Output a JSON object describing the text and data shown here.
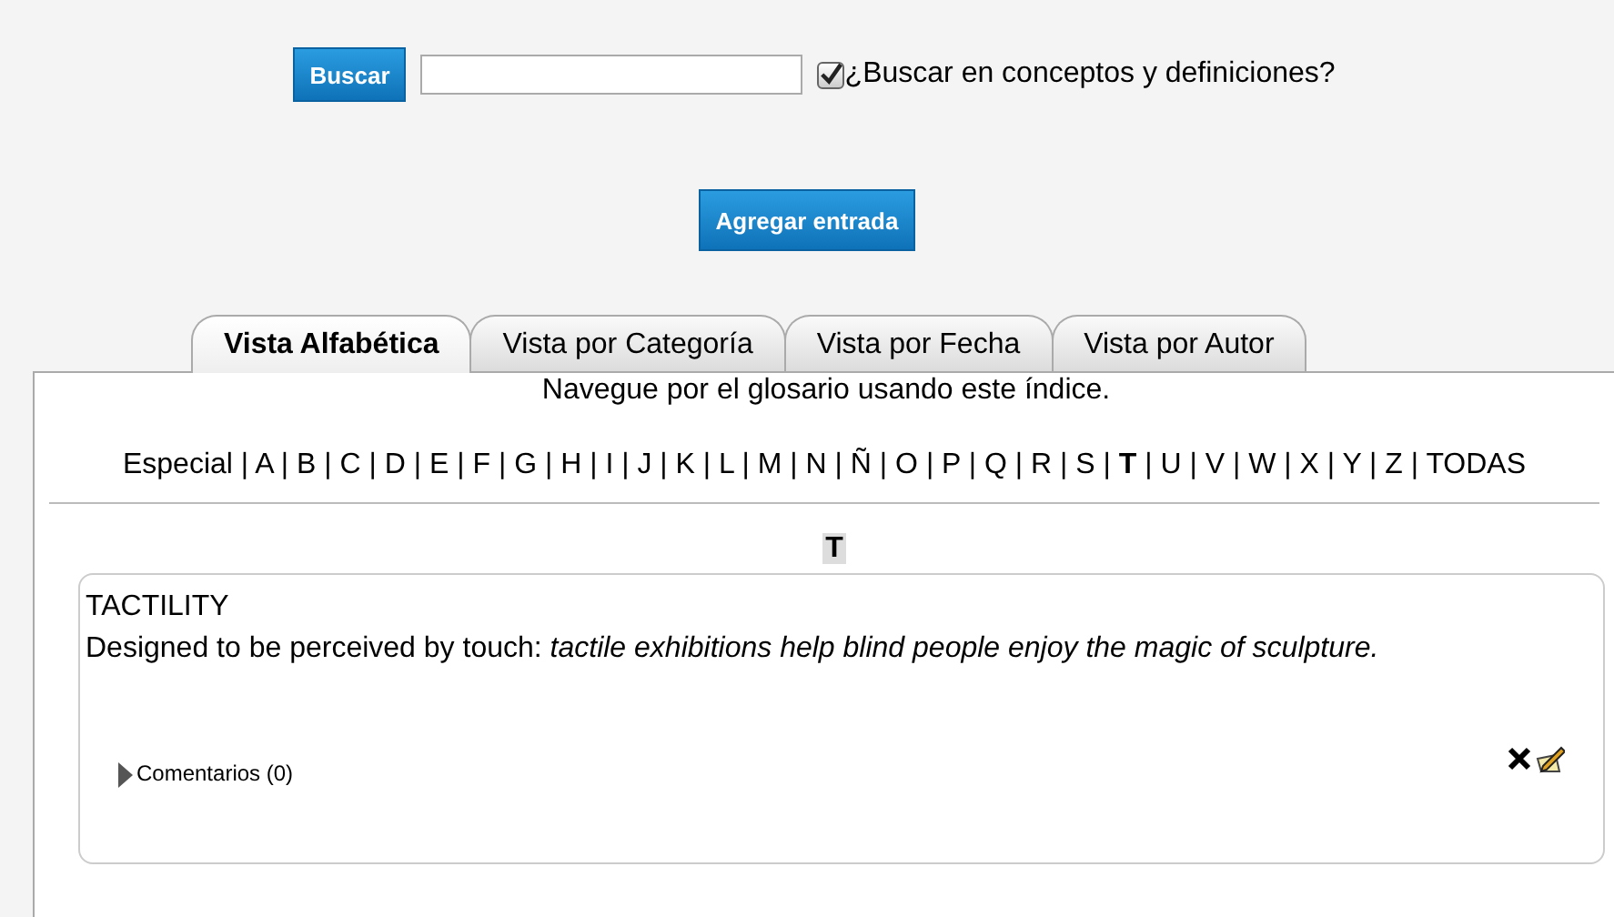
{
  "search": {
    "button": "Buscar",
    "option": {
      "label": "¿Buscar en conceptos y definiciones?",
      "checked": true
    }
  },
  "add_button": "Agregar entrada",
  "tabs": [
    {
      "label": "Vista Alfabética",
      "selected": true
    },
    {
      "label": "Vista por Categoría",
      "selected": false
    },
    {
      "label": "Vista por Fecha",
      "selected": false
    },
    {
      "label": "Vista por Autor",
      "selected": false
    }
  ],
  "index": {
    "hint": "Navegue por el glosario usando este índice.",
    "separator": "|",
    "letters": [
      {
        "label": "Especial",
        "selected": false
      },
      {
        "label": "A",
        "selected": false
      },
      {
        "label": "B",
        "selected": false
      },
      {
        "label": "C",
        "selected": false
      },
      {
        "label": "D",
        "selected": false
      },
      {
        "label": "E",
        "selected": false
      },
      {
        "label": "F",
        "selected": false
      },
      {
        "label": "G",
        "selected": false
      },
      {
        "label": "H",
        "selected": false
      },
      {
        "label": "I",
        "selected": false
      },
      {
        "label": "J",
        "selected": false
      },
      {
        "label": "K",
        "selected": false
      },
      {
        "label": "L",
        "selected": false
      },
      {
        "label": "M",
        "selected": false
      },
      {
        "label": "N",
        "selected": false
      },
      {
        "label": "Ñ",
        "selected": false
      },
      {
        "label": "O",
        "selected": false
      },
      {
        "label": "P",
        "selected": false
      },
      {
        "label": "Q",
        "selected": false
      },
      {
        "label": "R",
        "selected": false
      },
      {
        "label": "S",
        "selected": false
      },
      {
        "label": "T",
        "selected": true
      },
      {
        "label": "U",
        "selected": false
      },
      {
        "label": "V",
        "selected": false
      },
      {
        "label": "W",
        "selected": false
      },
      {
        "label": "X",
        "selected": false
      },
      {
        "label": "Y",
        "selected": false
      },
      {
        "label": "Z",
        "selected": false
      },
      {
        "label": "TODAS",
        "selected": false
      }
    ]
  },
  "section_letter": "T",
  "entries": [
    {
      "term": "TACTILITY",
      "definition": "Designed to be perceived by touch: *tactile exhibitions help blind people enjoy the magic of sculpture.*",
      "comments": "Comentarios (0)"
    }
  ]
}
